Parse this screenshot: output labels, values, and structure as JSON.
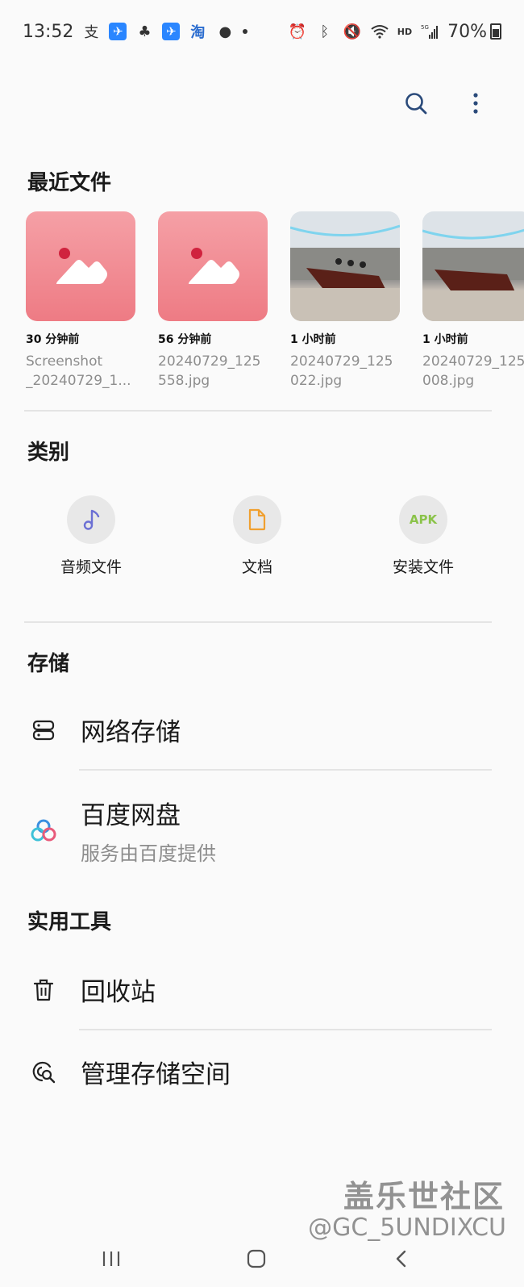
{
  "status_bar": {
    "time": "13:52",
    "app_icons": [
      "alipay-icon",
      "message-icon",
      "qq-icon",
      "message-icon",
      "taobao-icon",
      "bulb-icon",
      "dot-icon"
    ],
    "taobao_label": "淘",
    "alipay_label": "支",
    "hd_label": "HD",
    "signal_label": "5G",
    "battery": "70%"
  },
  "top_actions": {
    "search_icon": "search-icon",
    "more_icon": "more-vertical-icon"
  },
  "recent": {
    "title": "最近文件",
    "items": [
      {
        "time": "30 分钟前",
        "name": "Screenshot\n_20240729_1...",
        "thumb": "image-placeholder"
      },
      {
        "time": "56 分钟前",
        "name": "20240729_125\n558.jpg",
        "thumb": "image-placeholder"
      },
      {
        "time": "1 小时前",
        "name": "20240729_125\n022.jpg",
        "thumb": "photo"
      },
      {
        "time": "1 小时前",
        "name": "20240729_125\n008.jpg",
        "thumb": "photo"
      }
    ]
  },
  "categories": {
    "title": "类别",
    "items": [
      {
        "label": "音频文件",
        "icon": "music-note-icon"
      },
      {
        "label": "文档",
        "icon": "document-icon"
      },
      {
        "label": "安装文件",
        "icon": "apk-icon",
        "icon_text": "APK"
      }
    ]
  },
  "storage": {
    "title": "存储",
    "items": [
      {
        "title": "网络存储",
        "icon": "network-storage-icon"
      },
      {
        "title": "百度网盘",
        "subtitle": "服务由百度提供",
        "icon": "baidu-netdisk-icon"
      }
    ]
  },
  "tools": {
    "title": "实用工具",
    "items": [
      {
        "title": "回收站",
        "icon": "trash-icon"
      },
      {
        "title": "管理存储空间",
        "icon": "storage-manage-icon"
      }
    ]
  },
  "watermark": {
    "line1": "盖乐世社区",
    "line2": "@GC_5UNDIXCU"
  },
  "colors": {
    "accent": "#2a5599",
    "apk_green": "#8bc34a",
    "doc_orange": "#f0a030",
    "music_purple": "#6b6fd4"
  }
}
